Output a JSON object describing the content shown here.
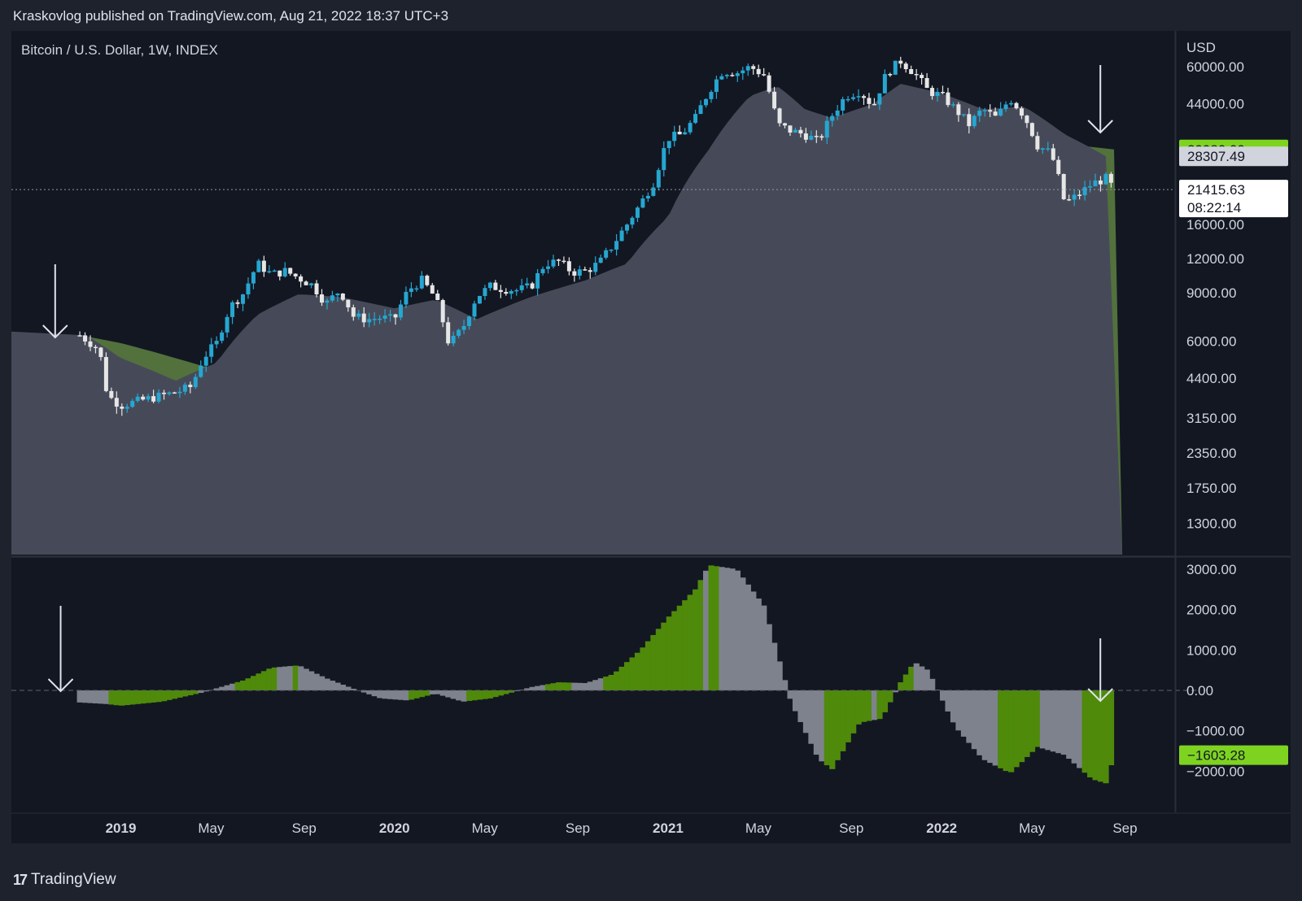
{
  "header": {
    "published": "Kraskovlog published on TradingView.com, Aug 21, 2022 18:37 UTC+3"
  },
  "footer": {
    "brand": "TradingView",
    "logo_mark": "17"
  },
  "colors": {
    "background": "#131722",
    "frame": "#1e222d",
    "bull_candle": "#26a6d1",
    "bear_candle": "#e6e6e6",
    "fast_ma_fill": "#464a58",
    "slow_ma_fill": "#55763e",
    "osc_green": "#4f8a0b",
    "osc_gray": "#7e828d",
    "tag_green": "#7ed321"
  },
  "chart_data": [
    {
      "type": "candlestick",
      "title": "Bitcoin / U.S. Dollar, 1W, INDEX",
      "currency": "USD",
      "scale": "log",
      "ylim": [
        1000,
        80000
      ],
      "y_ticks": [
        "60000.00",
        "44000.00",
        "16000.00",
        "12000.00",
        "9000.00",
        "6000.00",
        "4400.00",
        "3150.00",
        "2350.00",
        "1750.00",
        "1300.00"
      ],
      "x_ticks": [
        "2019",
        "May",
        "Sep",
        "2020",
        "May",
        "Sep",
        "2021",
        "May",
        "Sep",
        "2022",
        "May",
        "Sep"
      ],
      "series": [
        {
          "name": "fast average (gray area)",
          "last_value": "28307.49"
        },
        {
          "name": "slow average (green area)",
          "last_value": "29980.09"
        }
      ],
      "last_price": "21415.63",
      "countdown": "08:22:14",
      "annotations": [
        "down arrow near Dec 2018 low",
        "down arrow near Jul 2022"
      ],
      "close_path": [
        [
          2018.85,
          6300
        ],
        [
          2018.92,
          5600
        ],
        [
          2018.95,
          3800
        ],
        [
          2019.0,
          3500
        ],
        [
          2019.05,
          3600
        ],
        [
          2019.1,
          3700
        ],
        [
          2019.2,
          3900
        ],
        [
          2019.26,
          4100
        ],
        [
          2019.3,
          5200
        ],
        [
          2019.35,
          5900
        ],
        [
          2019.4,
          8000
        ],
        [
          2019.45,
          9000
        ],
        [
          2019.5,
          11500
        ],
        [
          2019.55,
          10500
        ],
        [
          2019.6,
          10800
        ],
        [
          2019.65,
          10200
        ],
        [
          2019.7,
          9600
        ],
        [
          2019.75,
          8200
        ],
        [
          2019.8,
          9200
        ],
        [
          2019.85,
          7400
        ],
        [
          2019.9,
          7200
        ],
        [
          2019.95,
          7300
        ],
        [
          2020.0,
          7200
        ],
        [
          2020.05,
          9200
        ],
        [
          2020.1,
          10000
        ],
        [
          2020.15,
          8600
        ],
        [
          2020.2,
          5800
        ],
        [
          2020.25,
          6700
        ],
        [
          2020.3,
          8700
        ],
        [
          2020.35,
          9500
        ],
        [
          2020.4,
          9300
        ],
        [
          2020.45,
          9200
        ],
        [
          2020.5,
          9500
        ],
        [
          2020.55,
          11500
        ],
        [
          2020.6,
          11700
        ],
        [
          2020.65,
          10700
        ],
        [
          2020.7,
          10800
        ],
        [
          2020.75,
          11600
        ],
        [
          2020.8,
          13500
        ],
        [
          2020.85,
          16000
        ],
        [
          2020.9,
          19000
        ],
        [
          2020.95,
          23000
        ],
        [
          2021.0,
          33000
        ],
        [
          2021.05,
          34000
        ],
        [
          2021.1,
          39000
        ],
        [
          2021.15,
          49000
        ],
        [
          2021.2,
          58000
        ],
        [
          2021.25,
          57000
        ],
        [
          2021.3,
          60000
        ],
        [
          2021.35,
          56000
        ],
        [
          2021.4,
          37000
        ],
        [
          2021.45,
          35000
        ],
        [
          2021.5,
          34000
        ],
        [
          2021.55,
          32000
        ],
        [
          2021.6,
          40000
        ],
        [
          2021.65,
          47000
        ],
        [
          2021.7,
          49000
        ],
        [
          2021.75,
          43000
        ],
        [
          2021.8,
          57000
        ],
        [
          2021.85,
          63000
        ],
        [
          2021.9,
          57000
        ],
        [
          2021.95,
          49000
        ],
        [
          2022.0,
          47000
        ],
        [
          2022.05,
          42000
        ],
        [
          2022.1,
          37000
        ],
        [
          2022.15,
          42000
        ],
        [
          2022.2,
          39000
        ],
        [
          2022.25,
          46000
        ],
        [
          2022.3,
          40000
        ],
        [
          2022.35,
          31000
        ],
        [
          2022.4,
          29000
        ],
        [
          2022.45,
          19000
        ],
        [
          2022.5,
          20500
        ],
        [
          2022.55,
          22500
        ],
        [
          2022.6,
          23500
        ],
        [
          2022.63,
          21415
        ]
      ],
      "fast_ma_path": [
        [
          2018.85,
          6500
        ],
        [
          2019.0,
          5200
        ],
        [
          2019.2,
          4300
        ],
        [
          2019.35,
          5000
        ],
        [
          2019.5,
          7500
        ],
        [
          2019.65,
          8900
        ],
        [
          2019.8,
          8700
        ],
        [
          2020.0,
          7900
        ],
        [
          2020.15,
          8500
        ],
        [
          2020.3,
          7200
        ],
        [
          2020.5,
          8700
        ],
        [
          2020.7,
          10000
        ],
        [
          2020.85,
          11500
        ],
        [
          2021.0,
          17000
        ],
        [
          2021.15,
          30000
        ],
        [
          2021.3,
          47000
        ],
        [
          2021.4,
          51000
        ],
        [
          2021.5,
          42000
        ],
        [
          2021.6,
          39000
        ],
        [
          2021.75,
          44000
        ],
        [
          2021.85,
          52000
        ],
        [
          2022.0,
          48000
        ],
        [
          2022.15,
          42000
        ],
        [
          2022.3,
          43000
        ],
        [
          2022.45,
          34000
        ],
        [
          2022.6,
          28300
        ]
      ],
      "slow_ma_path": [
        [
          2018.85,
          6300
        ],
        [
          2019.0,
          5900
        ],
        [
          2019.2,
          5200
        ],
        [
          2019.35,
          4700
        ],
        [
          2019.6,
          4900
        ],
        [
          2019.9,
          5200
        ],
        [
          2020.2,
          5800
        ],
        [
          2020.5,
          6600
        ],
        [
          2020.75,
          7000
        ],
        [
          2021.0,
          8500
        ],
        [
          2021.2,
          12500
        ],
        [
          2021.4,
          17000
        ],
        [
          2021.6,
          20000
        ],
        [
          2021.8,
          24000
        ],
        [
          2022.0,
          28500
        ],
        [
          2022.2,
          31500
        ],
        [
          2022.35,
          32000
        ],
        [
          2022.5,
          31000
        ],
        [
          2022.63,
          29980
        ]
      ]
    },
    {
      "type": "area",
      "title": "oscillator",
      "ylim": [
        -3000,
        3200
      ],
      "y_ticks": [
        "3000.00",
        "2000.00",
        "1000.00",
        "0.00",
        "−1000.00",
        "−2000.00"
      ],
      "last_value": "−1603.28",
      "annotations": [
        "down arrow near Dec 2018",
        "down arrow near Jul 2022"
      ],
      "values": [
        [
          2018.85,
          -300
        ],
        [
          2018.95,
          -340
        ],
        [
          2019.0,
          -380
        ],
        [
          2019.15,
          -280
        ],
        [
          2019.3,
          -50
        ],
        [
          2019.45,
          250
        ],
        [
          2019.55,
          560
        ],
        [
          2019.65,
          620
        ],
        [
          2019.75,
          300
        ],
        [
          2019.85,
          40
        ],
        [
          2019.95,
          -200
        ],
        [
          2020.05,
          -250
        ],
        [
          2020.15,
          -80
        ],
        [
          2020.25,
          -280
        ],
        [
          2020.35,
          -200
        ],
        [
          2020.5,
          80
        ],
        [
          2020.6,
          200
        ],
        [
          2020.7,
          180
        ],
        [
          2020.8,
          400
        ],
        [
          2020.9,
          1000
        ],
        [
          2021.0,
          1800
        ],
        [
          2021.1,
          2500
        ],
        [
          2021.15,
          3100
        ],
        [
          2021.25,
          3000
        ],
        [
          2021.35,
          2100
        ],
        [
          2021.45,
          -300
        ],
        [
          2021.55,
          -1700
        ],
        [
          2021.6,
          -1950
        ],
        [
          2021.7,
          -800
        ],
        [
          2021.78,
          -700
        ],
        [
          2021.85,
          200
        ],
        [
          2021.9,
          700
        ],
        [
          2021.95,
          500
        ],
        [
          2022.05,
          -900
        ],
        [
          2022.15,
          -1700
        ],
        [
          2022.25,
          -2050
        ],
        [
          2022.35,
          -1400
        ],
        [
          2022.45,
          -1600
        ],
        [
          2022.55,
          -2200
        ],
        [
          2022.6,
          -2300
        ],
        [
          2022.63,
          -1603
        ]
      ],
      "green_segments": [
        [
          2018.95,
          2019.28
        ],
        [
          2019.42,
          2019.57
        ],
        [
          2019.63,
          2019.65
        ],
        [
          2020.05,
          2020.13
        ],
        [
          2020.27,
          2020.43
        ],
        [
          2020.55,
          2020.65
        ],
        [
          2020.76,
          2021.12
        ],
        [
          2021.15,
          2021.18
        ],
        [
          2021.58,
          2021.74
        ],
        [
          2021.76,
          2021.82
        ],
        [
          2021.84,
          2021.9
        ],
        [
          2022.2,
          2022.35
        ],
        [
          2022.52,
          2022.63
        ]
      ]
    }
  ]
}
